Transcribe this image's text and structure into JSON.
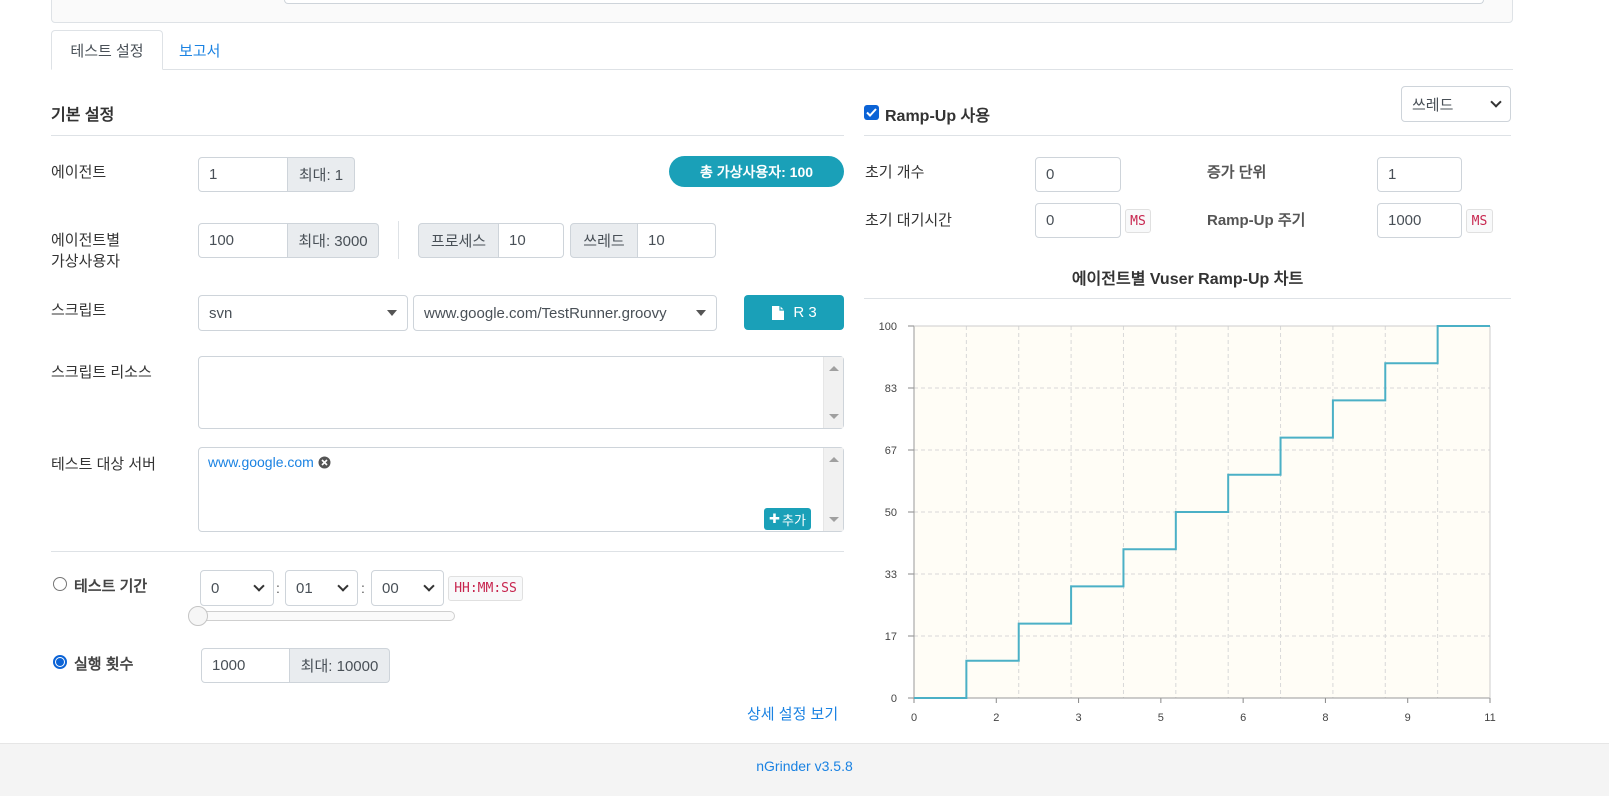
{
  "tabs": [
    {
      "label": "테스트 설정",
      "active": true
    },
    {
      "label": "보고서",
      "active": false
    }
  ],
  "basic": {
    "title": "기본 설정",
    "agent": {
      "label": "에이전트",
      "value": "1",
      "max": "최대: 1"
    },
    "total_vusers": "총 가상사용자: 100",
    "vuser_per_agent": {
      "label_line1": "에이전트별",
      "label_line2": "가상사용자",
      "value": "100",
      "max": "최대: 3000"
    },
    "process": {
      "label": "프로세스",
      "value": "10"
    },
    "thread": {
      "label": "쓰레드",
      "value": "10"
    },
    "script": {
      "label": "스크립트",
      "repo": "svn",
      "file": "www.google.com/TestRunner.groovy",
      "revision_button": "R 3"
    },
    "script_resource": {
      "label": "스크립트 리소스"
    },
    "target_server": {
      "label": "테스트 대상 서버",
      "host": "www.google.com",
      "add_button": "추가"
    },
    "duration": {
      "label": "테스트 기간",
      "hours": "0",
      "minutes": "01",
      "seconds": "00",
      "format": "HH:MM:SS",
      "selected": false
    },
    "run_count": {
      "label": "실행 횟수",
      "value": "1000",
      "max": "최대: 10000",
      "selected": true
    },
    "advanced_link": "상세 설정 보기"
  },
  "rampup": {
    "enabled": true,
    "label": "Ramp-Up 사용",
    "type_select": "쓰레드",
    "initial_count": {
      "label": "초기 개수",
      "value": "0"
    },
    "increment": {
      "label": "증가 단위",
      "value": "1"
    },
    "initial_sleep": {
      "label": "초기 대기시간",
      "value": "0",
      "unit": "MS"
    },
    "interval": {
      "label": "Ramp-Up 주기",
      "value": "1000",
      "unit": "MS"
    },
    "chart_title": "에이전트별 Vuser Ramp-Up 차트"
  },
  "chart_data": {
    "type": "line",
    "title": "에이전트별 Vuser Ramp-Up 차트",
    "xlabel": "",
    "ylabel": "",
    "xlim": [
      0,
      11
    ],
    "ylim": [
      0,
      100
    ],
    "x_ticks": [
      "0",
      "2",
      "3",
      "5",
      "6",
      "8",
      "9",
      "11"
    ],
    "y_ticks": [
      "0",
      "17",
      "33",
      "50",
      "67",
      "83",
      "100"
    ],
    "grid": true,
    "line_color": "#4bb0c6",
    "background": "#fffdf6",
    "series": [
      {
        "step": true,
        "x": [
          0,
          1,
          2,
          3,
          4,
          5,
          6,
          7,
          8,
          9,
          10,
          11
        ],
        "y": [
          0,
          10,
          20,
          30,
          40,
          50,
          60,
          70,
          80,
          90,
          100,
          100
        ]
      }
    ]
  },
  "footer": {
    "version": "nGrinder v3.5.8"
  }
}
